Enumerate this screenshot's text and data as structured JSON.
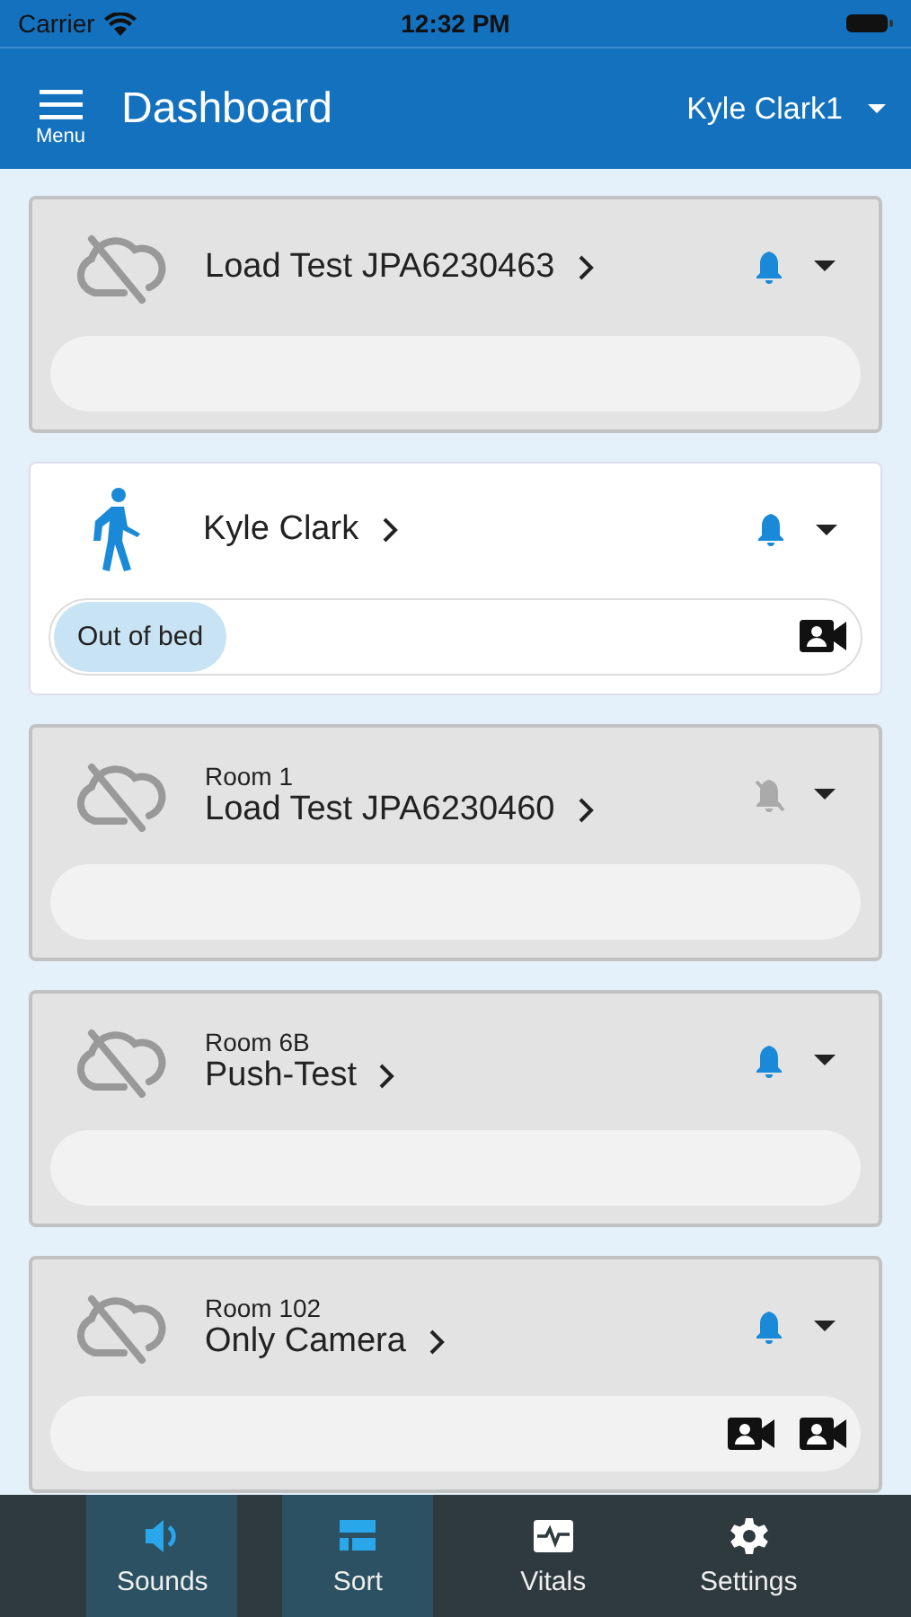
{
  "status_bar": {
    "carrier": "Carrier",
    "time": "12:32 PM"
  },
  "header": {
    "menu_label": "Menu",
    "title": "Dashboard",
    "user": "Kyle Clark1"
  },
  "cards": [
    {
      "kind": "offline",
      "name": "Load Test JPA6230463",
      "bell_muted": false
    },
    {
      "kind": "person",
      "name": "Kyle Clark",
      "bell_muted": false,
      "tags": [
        "Out of bed"
      ],
      "cameras": [
        {
          "kind": "video"
        }
      ]
    },
    {
      "kind": "offline",
      "room": "Room 1",
      "name": "Load Test JPA6230460",
      "bell_muted": true
    },
    {
      "kind": "offline",
      "room": "Room 6B",
      "name": "Push-Test",
      "bell_muted": false
    },
    {
      "kind": "offline",
      "room": "Room 102",
      "name": "Only Camera",
      "bell_muted": false,
      "cameras": [
        {
          "kind": "video"
        },
        {
          "kind": "video"
        }
      ]
    }
  ],
  "tab_bar": [
    {
      "kind": "sounds",
      "label": "Sounds",
      "selected": true
    },
    {
      "kind": "sort",
      "label": "Sort",
      "selected": true
    },
    {
      "kind": "vitals",
      "label": "Vitals",
      "selected": false
    },
    {
      "kind": "settings",
      "label": "Settings",
      "selected": false
    }
  ]
}
